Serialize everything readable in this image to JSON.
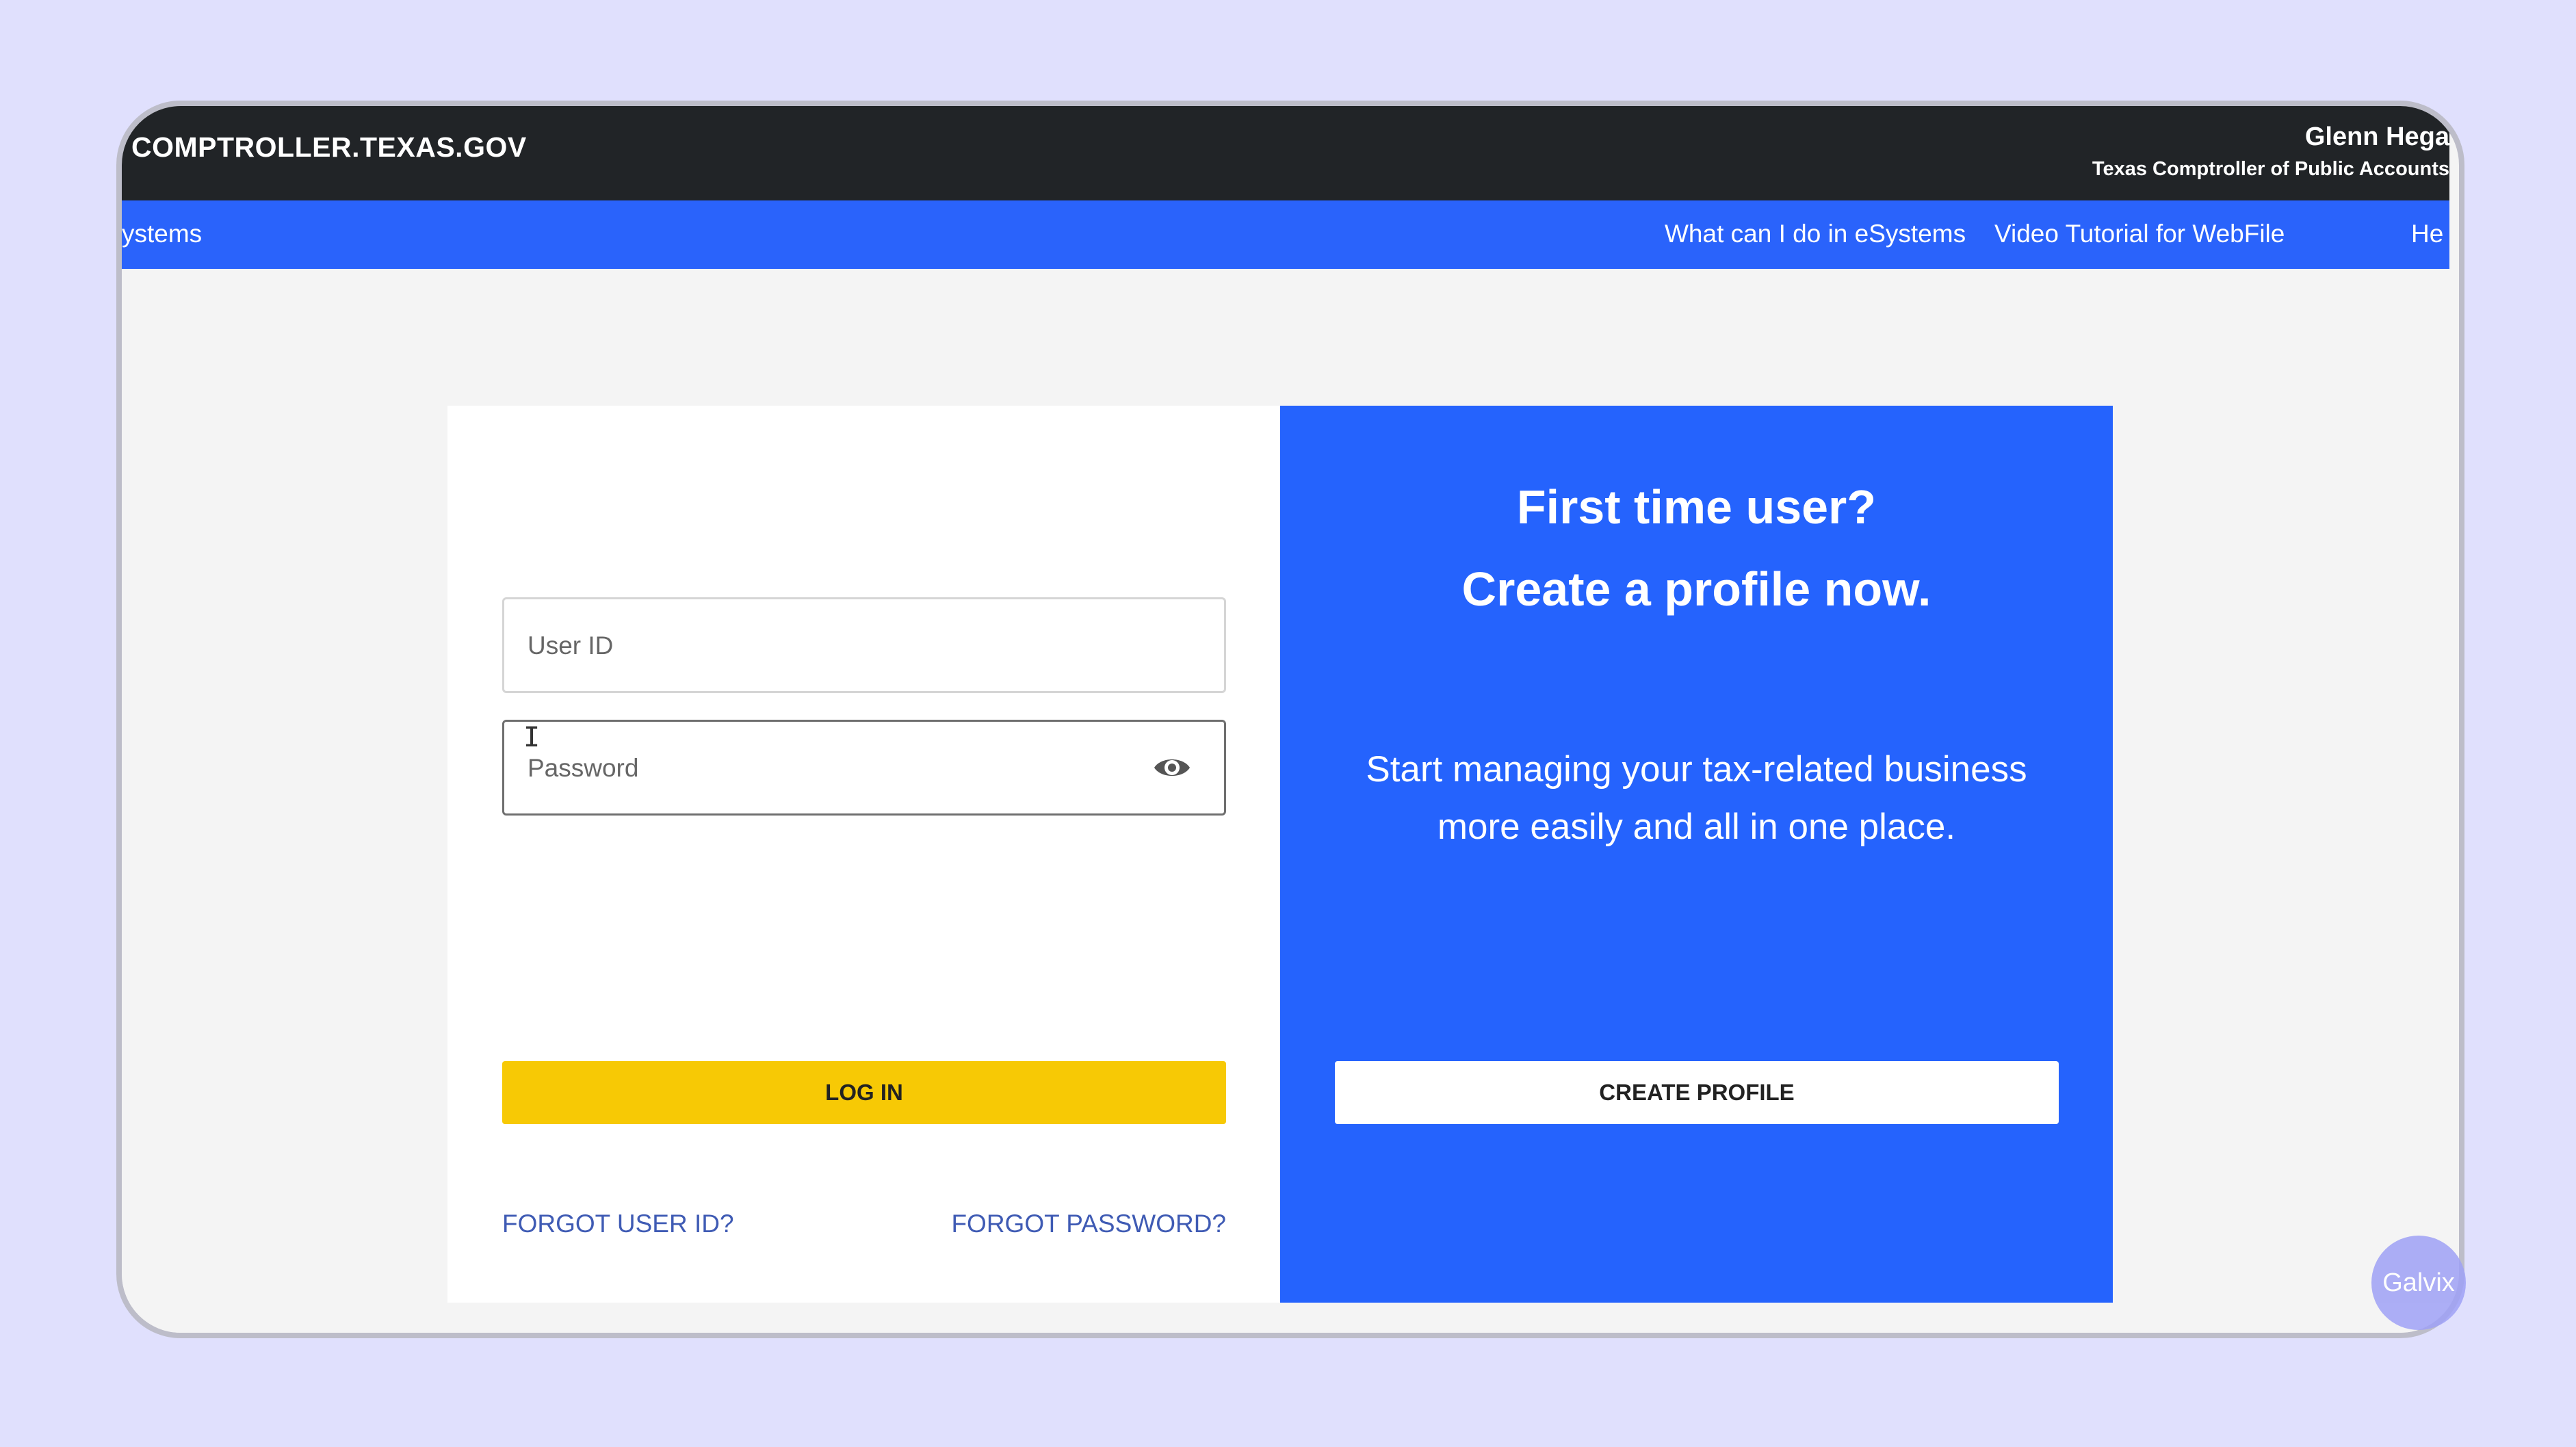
{
  "header": {
    "site_name": "COMPTROLLER.TEXAS.GOV",
    "official_name": "Glenn Hega",
    "official_title": "Texas Comptroller of Public Accounts"
  },
  "nav": {
    "items": [
      {
        "label": "ystems"
      },
      {
        "label": "What can I do in eSystems"
      },
      {
        "label": "Video Tutorial for WebFile"
      },
      {
        "label": "He"
      }
    ]
  },
  "login": {
    "user_id_placeholder": "User ID",
    "user_id_value": "",
    "password_placeholder": "Password",
    "password_value": "",
    "show_password_icon": "eye-icon",
    "login_label": "LOG IN",
    "forgot_user_id_label": "FORGOT USER ID?",
    "forgot_password_label": "FORGOT PASSWORD?"
  },
  "signup": {
    "heading_line1": "First time user?",
    "heading_line2": "Create a profile now.",
    "text_line1": "Start managing your tax-related business",
    "text_line2": "more easily and all in one place.",
    "create_label": "CREATE PROFILE"
  },
  "watermark": {
    "label": "Galvix"
  },
  "colors": {
    "page_background": "#e0e0fd",
    "topbar": "#212427",
    "navbar": "#2a63fb",
    "signup_panel": "#2563fd",
    "login_button": "#f7c905",
    "link": "#3f5bb4"
  }
}
